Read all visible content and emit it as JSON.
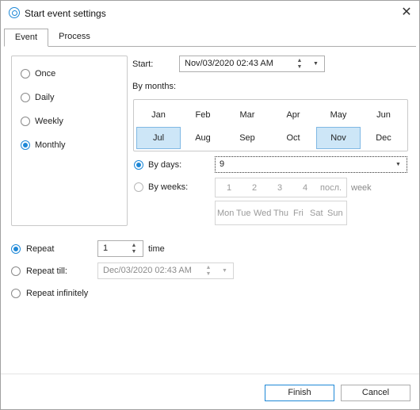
{
  "window": {
    "title": "Start event settings",
    "close_glyph": "✕"
  },
  "tabs": [
    {
      "label": "Event"
    },
    {
      "label": "Process"
    }
  ],
  "frequency": {
    "options": [
      {
        "label": "Once",
        "checked": false
      },
      {
        "label": "Daily",
        "checked": false
      },
      {
        "label": "Weekly",
        "checked": false
      },
      {
        "label": "Monthly",
        "checked": true
      }
    ]
  },
  "start": {
    "label": "Start:",
    "value": "Nov/03/2020 02:43 AM"
  },
  "by_months": {
    "label": "By months:",
    "months": [
      {
        "label": "Jan",
        "selected": false
      },
      {
        "label": "Feb",
        "selected": false
      },
      {
        "label": "Mar",
        "selected": false
      },
      {
        "label": "Apr",
        "selected": false
      },
      {
        "label": "May",
        "selected": false
      },
      {
        "label": "Jun",
        "selected": false
      },
      {
        "label": "Jul",
        "selected": true
      },
      {
        "label": "Aug",
        "selected": false
      },
      {
        "label": "Sep",
        "selected": false
      },
      {
        "label": "Oct",
        "selected": false
      },
      {
        "label": "Nov",
        "selected": true
      },
      {
        "label": "Dec",
        "selected": false
      }
    ]
  },
  "by_days": {
    "label": "By days:",
    "checked": true,
    "value": "9"
  },
  "by_weeks": {
    "label": "By weeks:",
    "checked": false,
    "week_numbers": [
      "1",
      "2",
      "3",
      "4",
      "посл."
    ],
    "suffix": "week",
    "weekdays": [
      "Mon",
      "Tue",
      "Wed",
      "Thu",
      "Fri",
      "Sat",
      "Sun"
    ]
  },
  "repeat": {
    "label": "Repeat",
    "checked": true,
    "count": "1",
    "unit": "time"
  },
  "repeat_till": {
    "label": "Repeat till:",
    "checked": false,
    "value": "Dec/03/2020 02:43 AM"
  },
  "repeat_infinitely": {
    "label": "Repeat infinitely",
    "checked": false
  },
  "buttons": {
    "finish": "Finish",
    "cancel": "Cancel"
  },
  "colors": {
    "accent": "#1e88d7",
    "month_selected_bg": "#cde6f7"
  }
}
